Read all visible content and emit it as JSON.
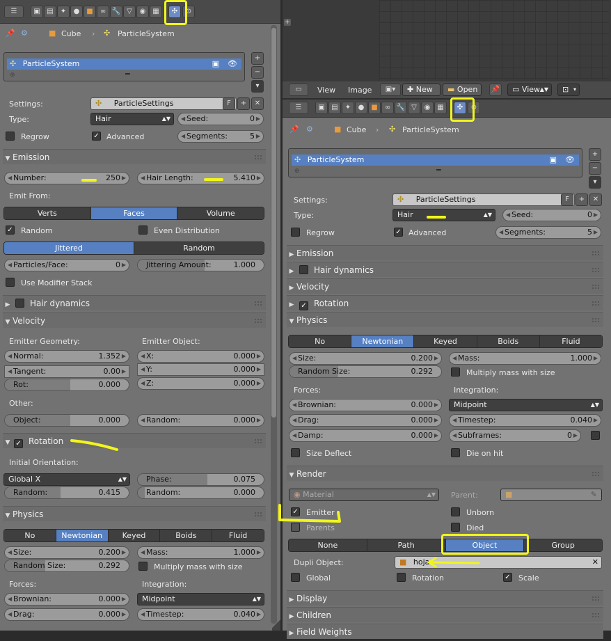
{
  "left": {
    "breadcrumb": {
      "object": "Cube",
      "psys": "ParticleSystem"
    },
    "list_item": "ParticleSystem",
    "settings": {
      "label": "Settings:",
      "value": "ParticleSettings",
      "fake_user": "F"
    },
    "type": {
      "label": "Type:",
      "value": "Hair"
    },
    "seed": {
      "label": "Seed:",
      "value": "0"
    },
    "regrow": "Regrow",
    "advanced": "Advanced",
    "segments": {
      "label": "Segments:",
      "value": "5"
    },
    "emission": {
      "title": "Emission",
      "number": {
        "label": "Number:",
        "value": "250"
      },
      "hair_length": {
        "label": "Hair Length:",
        "value": "5.410"
      },
      "emit_from": "Emit From:",
      "emit_opts": [
        "Verts",
        "Faces",
        "Volume"
      ],
      "random": "Random",
      "even_dist": "Even Distribution",
      "dist_opts": [
        "Jittered",
        "Random"
      ],
      "ppf": {
        "label": "Particles/Face:",
        "value": "0"
      },
      "jit": {
        "label": "Jittering Amount:",
        "value": "1.000"
      },
      "use_mod": "Use Modifier Stack"
    },
    "hair_dynamics": "Hair dynamics",
    "velocity": {
      "title": "Velocity",
      "emitter_geom": "Emitter Geometry:",
      "emitter_obj": "Emitter Object:",
      "normal": {
        "label": "Normal:",
        "value": "1.352"
      },
      "tangent": {
        "label": "Tangent:",
        "value": "0.00"
      },
      "rot": {
        "label": "Rot:",
        "value": "0.000"
      },
      "x": {
        "label": "X:",
        "value": "0.000"
      },
      "y": {
        "label": "Y:",
        "value": "0.000"
      },
      "z": {
        "label": "Z:",
        "value": "0.000"
      },
      "other": "Other:",
      "object": {
        "label": "Object:",
        "value": "0.000"
      },
      "random": {
        "label": "Random:",
        "value": "0.000"
      }
    },
    "rotation": {
      "title": "Rotation",
      "init_orient": "Initial Orientation:",
      "orient_value": "Global X",
      "random": {
        "label": "Random:",
        "value": "0.415"
      },
      "phase": {
        "label": "Phase:",
        "value": "0.075"
      },
      "random2": {
        "label": "Random:",
        "value": "0.000"
      }
    },
    "physics": {
      "title": "Physics",
      "opts": [
        "No",
        "Newtonian",
        "Keyed",
        "Boids",
        "Fluid"
      ],
      "size": {
        "label": "Size:",
        "value": "0.200"
      },
      "random_size": {
        "label": "Random Size:",
        "value": "0.292"
      },
      "mass": {
        "label": "Mass:",
        "value": "1.000"
      },
      "mult_mass": "Multiply mass with size",
      "forces": "Forces:",
      "integration": "Integration:",
      "brownian": {
        "label": "Brownian:",
        "value": "0.000"
      },
      "midpoint": "Midpoint",
      "drag": {
        "label": "Drag:",
        "value": "0.000"
      },
      "timestep": {
        "label": "Timestep:",
        "value": "0.040"
      }
    }
  },
  "right": {
    "header": {
      "view": "View",
      "image": "Image",
      "new": "New",
      "open": "Open",
      "view2": "View"
    },
    "breadcrumb": {
      "object": "Cube",
      "psys": "ParticleSystem"
    },
    "list_item": "ParticleSystem",
    "settings": {
      "label": "Settings:",
      "value": "ParticleSettings",
      "fake_user": "F"
    },
    "type": {
      "label": "Type:",
      "value": "Hair"
    },
    "seed": {
      "label": "Seed:",
      "value": "0"
    },
    "regrow": "Regrow",
    "advanced": "Advanced",
    "segments": {
      "label": "Segments:",
      "value": "5"
    },
    "sections": {
      "emission": "Emission",
      "hair_dynamics": "Hair dynamics",
      "velocity": "Velocity",
      "rotation": "Rotation"
    },
    "physics": {
      "title": "Physics",
      "opts": [
        "No",
        "Newtonian",
        "Keyed",
        "Boids",
        "Fluid"
      ],
      "size": {
        "label": "Size:",
        "value": "0.200"
      },
      "random_size": {
        "label": "Random Size:",
        "value": "0.292"
      },
      "mass": {
        "label": "Mass:",
        "value": "1.000"
      },
      "mult_mass": "Multiply mass with size",
      "forces": "Forces:",
      "integration": "Integration:",
      "brownian": {
        "label": "Brownian:",
        "value": "0.000"
      },
      "midpoint": "Midpoint",
      "drag": {
        "label": "Drag:",
        "value": "0.000"
      },
      "timestep": {
        "label": "Timestep:",
        "value": "0.040"
      },
      "damp": {
        "label": "Damp:",
        "value": "0.000"
      },
      "subframes": {
        "label": "Subframes:",
        "value": "0"
      },
      "size_deflect": "Size Deflect",
      "die_on_hit": "Die on hit"
    },
    "render": {
      "title": "Render",
      "material": "Material",
      "parent": "Parent:",
      "emitter": "Emitter",
      "unborn": "Unborn",
      "parents": "Parents",
      "died": "Died",
      "opts": [
        "None",
        "Path",
        "Object",
        "Group"
      ],
      "dupli_label": "Dupli Object:",
      "dupli_value": "hoja",
      "global": "Global",
      "rotation": "Rotation",
      "scale": "Scale"
    },
    "display": "Display",
    "children": "Children",
    "field_weights": "Field Weights"
  }
}
